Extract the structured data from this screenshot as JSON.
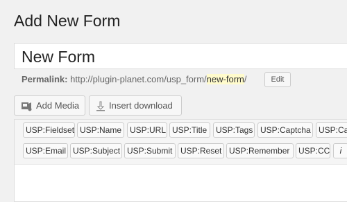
{
  "page": {
    "title": "Add New Form"
  },
  "post_title": {
    "value": "New Form"
  },
  "permalink": {
    "label": "Permalink:",
    "url_base": "http://plugin-planet.com/usp_form/",
    "slug": "new-form",
    "trailing": "/",
    "edit_label": "Edit"
  },
  "media_buttons": {
    "add_media": {
      "label": "Add Media",
      "icon": "add-media-icon"
    },
    "insert_download": {
      "label": "Insert download",
      "icon": "download-icon"
    }
  },
  "quicktags": {
    "row1": [
      "USP:Fieldset",
      "USP:Name",
      "USP:URL",
      "USP:Title",
      "USP:Tags",
      "USP:Captcha",
      "USP:Ca"
    ],
    "row2": [
      "USP:Email",
      "USP:Subject",
      "USP:Submit",
      "USP:Reset",
      "USP:Remember",
      "USP:CC",
      "i"
    ]
  }
}
